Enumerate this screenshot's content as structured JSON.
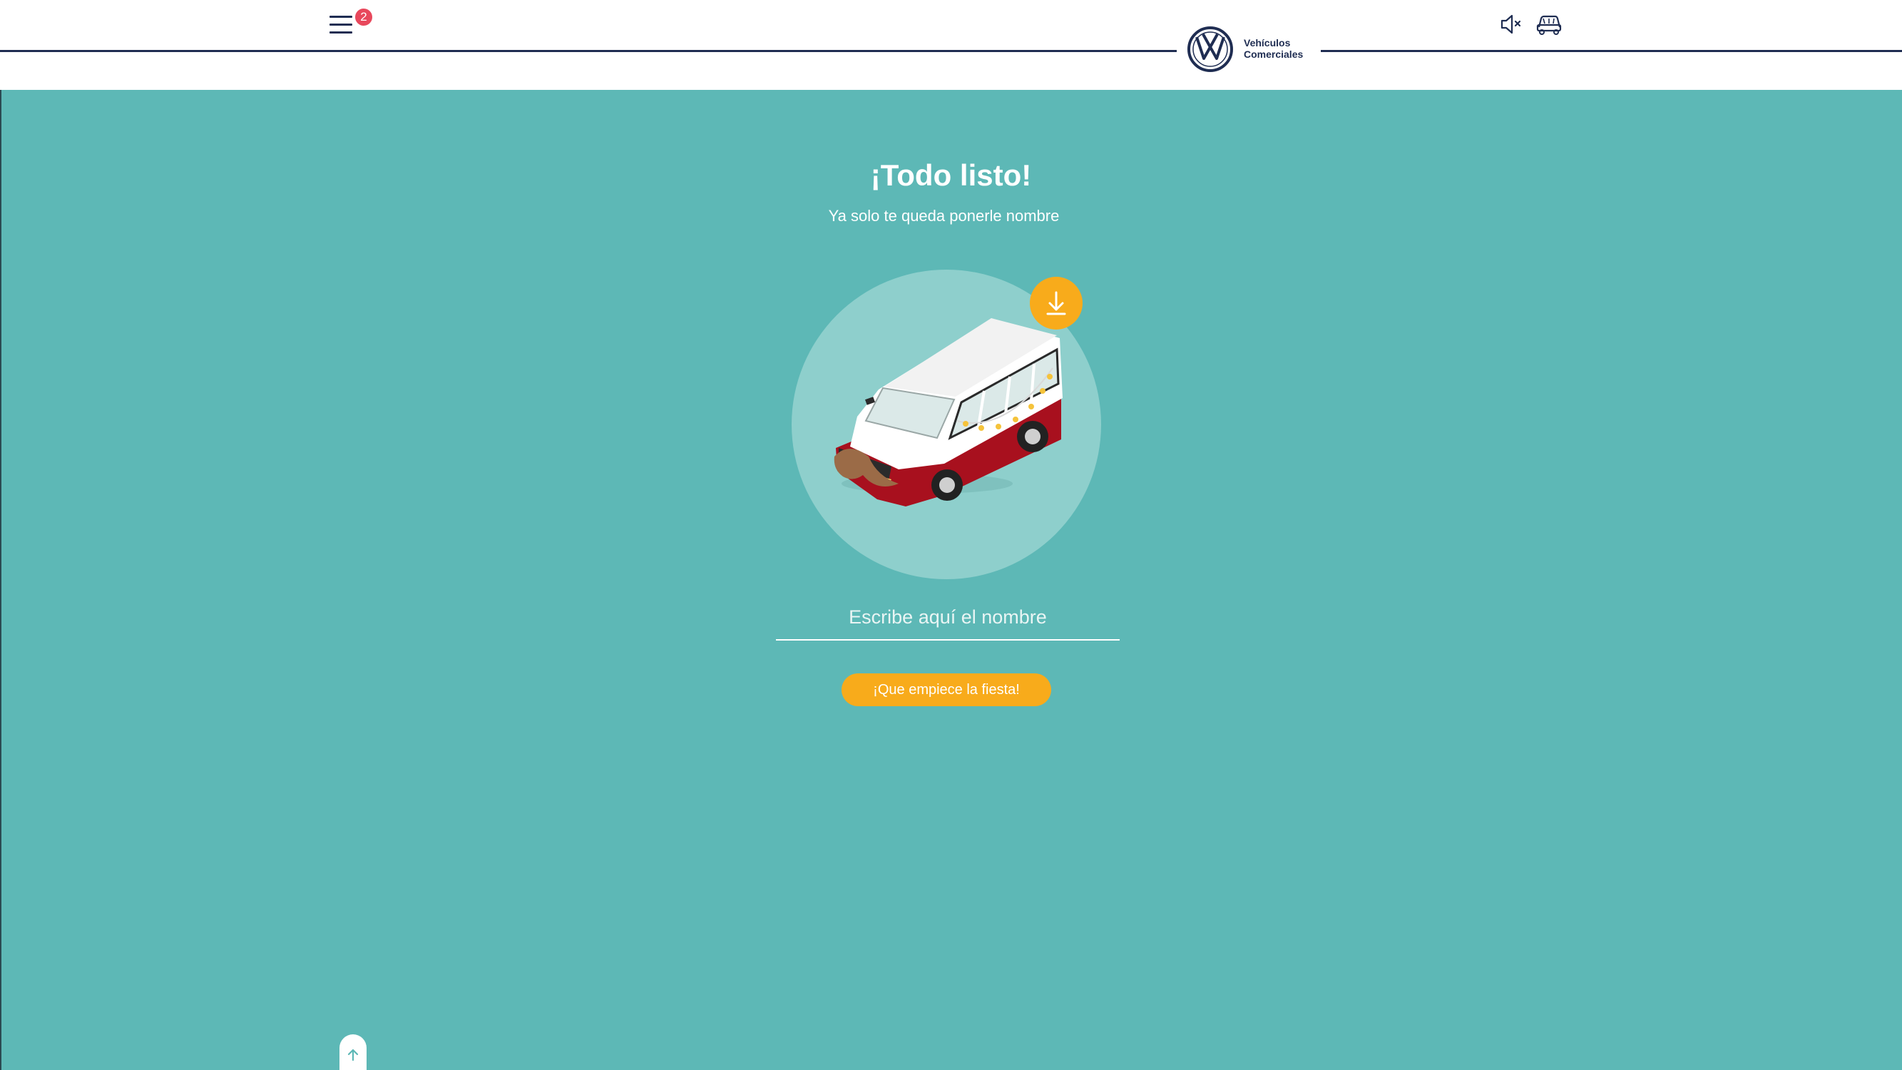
{
  "header": {
    "menu_badge_count": "2",
    "brand": {
      "line1": "Vehículos",
      "line2": "Comerciales",
      "logo_icon": "vw-logo-icon",
      "color": "#1f2d52"
    },
    "icons": {
      "menu": "hamburger-menu-icon",
      "sound": "sound-muted-icon",
      "car": "car-icon"
    }
  },
  "main": {
    "title": "¡Todo listo!",
    "subtitle": "Ya solo te queda ponerle nombre",
    "name_input": {
      "placeholder": "Escribe aquí el nombre",
      "value": ""
    },
    "cta_label": "¡Que empiece la fiesta!",
    "download_icon": "download-icon",
    "scroll_top_icon": "arrow-up-icon"
  },
  "colors": {
    "background": "#5db8b6",
    "circle": "#8ecfcc",
    "accent": "#f8ab1b",
    "badge": "#e8485c",
    "van_body": "#a8101e",
    "van_roof": "#ffffff"
  }
}
